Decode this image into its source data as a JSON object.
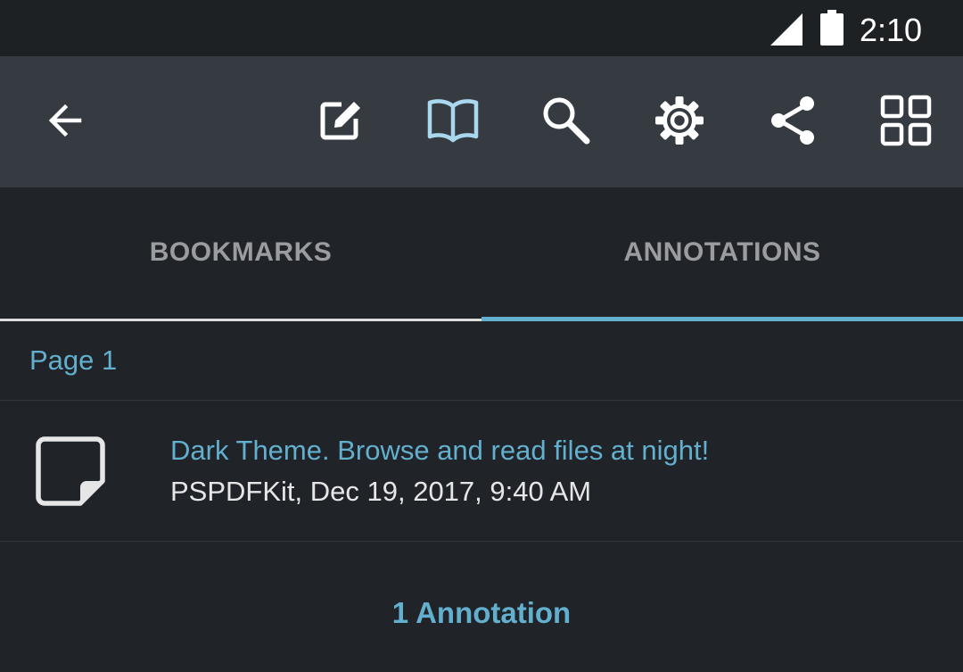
{
  "status_bar": {
    "time": "2:10",
    "icons": [
      "cellular-signal-icon",
      "battery-icon"
    ]
  },
  "toolbar": {
    "back_icon": "arrow-left-icon",
    "actions": [
      {
        "name": "edit-annotations",
        "icon": "pencil-square-icon"
      },
      {
        "name": "outline",
        "icon": "open-book-icon",
        "active": true
      },
      {
        "name": "search",
        "icon": "magnifier-icon"
      },
      {
        "name": "settings",
        "icon": "gear-icon"
      },
      {
        "name": "share",
        "icon": "share-icon"
      },
      {
        "name": "thumbnail-grid",
        "icon": "grid-icon"
      }
    ]
  },
  "tabs": [
    {
      "label": "BOOKMARKS",
      "selected": false
    },
    {
      "label": "ANNOTATIONS",
      "selected": true
    }
  ],
  "annotations": {
    "section_title": "Page 1",
    "items": [
      {
        "icon": "sticky-note-icon",
        "title": "Dark Theme. Browse and read files at night!",
        "subtitle": "PSPDFKit, Dec 19, 2017, 9:40 AM"
      }
    ],
    "count_label": "1 Annotation"
  },
  "colors": {
    "background": "#202328",
    "toolbar": "#363b42",
    "status_bar": "#1e2124",
    "accent": "#62afce",
    "active_icon": "#a9d7ee",
    "icon": "#ffffff",
    "tab_text": "#9a9c9f"
  }
}
